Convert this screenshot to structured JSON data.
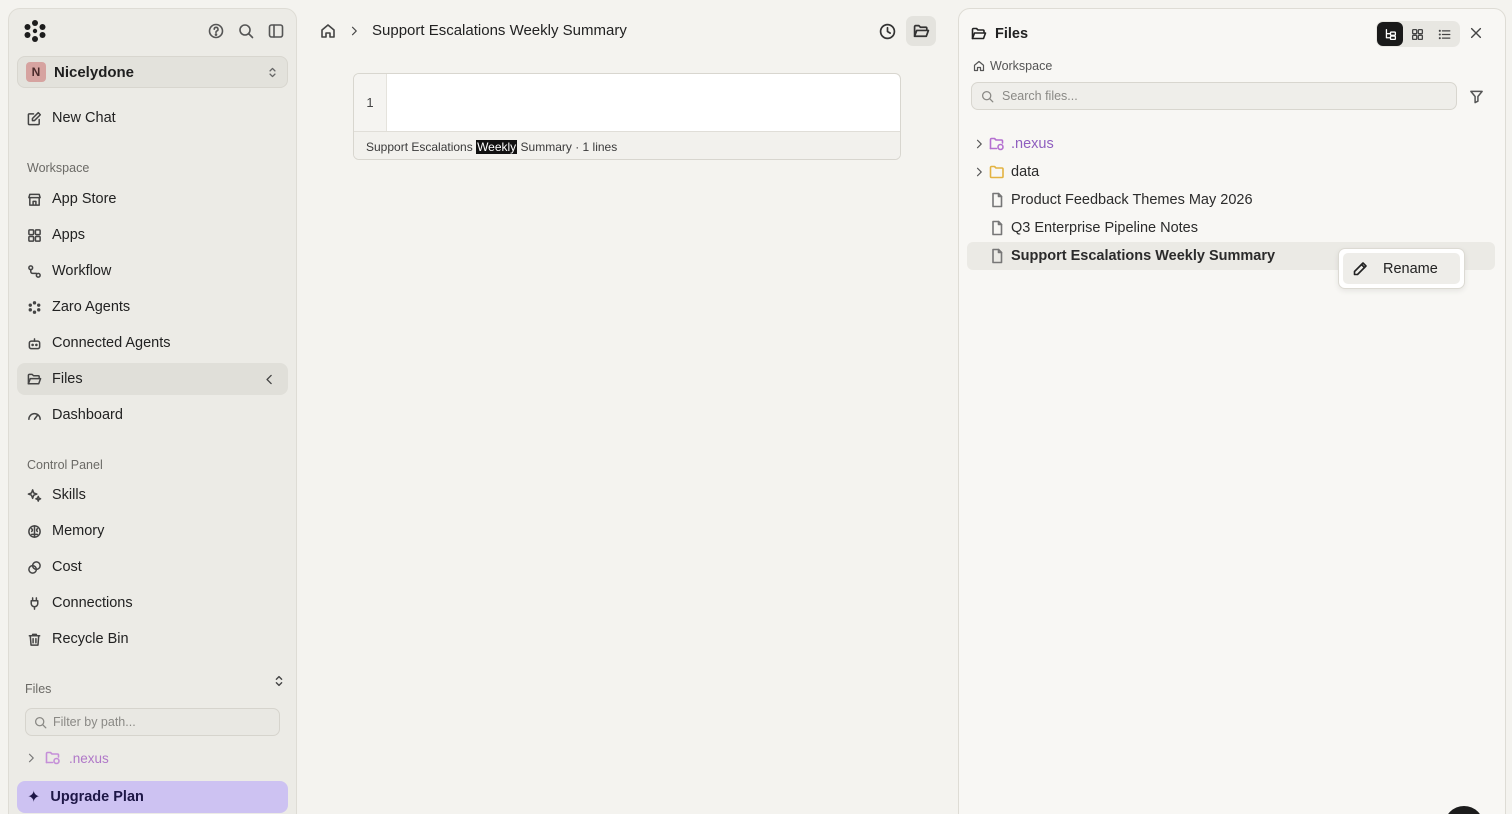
{
  "sidebar": {
    "org": {
      "initial": "N",
      "name": "Nicelydone"
    },
    "new_chat": "New Chat",
    "workspace_label": "Workspace",
    "workspace_items": [
      {
        "label": "App Store",
        "icon": "store-icon"
      },
      {
        "label": "Apps",
        "icon": "grid-icon"
      },
      {
        "label": "Workflow",
        "icon": "workflow-icon"
      },
      {
        "label": "Zaro Agents",
        "icon": "agents-icon"
      },
      {
        "label": "Connected Agents",
        "icon": "robot-icon"
      },
      {
        "label": "Files",
        "icon": "folder-open-icon",
        "active": true
      },
      {
        "label": "Dashboard",
        "icon": "gauge-icon"
      }
    ],
    "control_label": "Control Panel",
    "control_items": [
      {
        "label": "Skills",
        "icon": "sparkle-icon"
      },
      {
        "label": "Memory",
        "icon": "brain-icon"
      },
      {
        "label": "Cost",
        "icon": "coins-icon"
      },
      {
        "label": "Connections",
        "icon": "plug-icon"
      },
      {
        "label": "Recycle Bin",
        "icon": "trash-icon"
      }
    ],
    "files_label": "Files",
    "filter_placeholder": "Filter by path...",
    "tree_nexus": ".nexus",
    "upgrade": "Upgrade Plan"
  },
  "header": {
    "title": "Support Escalations Weekly Summary"
  },
  "editor": {
    "line_number": "1",
    "status_before": "Support Escalations ",
    "status_highlight": "Weekly",
    "status_after": " Summary · 1 lines"
  },
  "files_panel": {
    "title": "Files",
    "workspace": "Workspace",
    "search_placeholder": "Search files...",
    "tree": [
      {
        "label": ".nexus",
        "type": "folder-special"
      },
      {
        "label": "data",
        "type": "folder"
      },
      {
        "label": "Product Feedback Themes May 2026",
        "type": "file"
      },
      {
        "label": "Q3 Enterprise Pipeline Notes",
        "type": "file"
      },
      {
        "label": "Support Escalations Weekly Summary",
        "type": "file",
        "selected": true
      }
    ],
    "context_menu": {
      "rename": "Rename"
    }
  },
  "colors": {
    "accent_upgrade": "#cdc2f2",
    "nexus_purple": "#8f5fbf",
    "folder_yellow": "#e3b341"
  }
}
